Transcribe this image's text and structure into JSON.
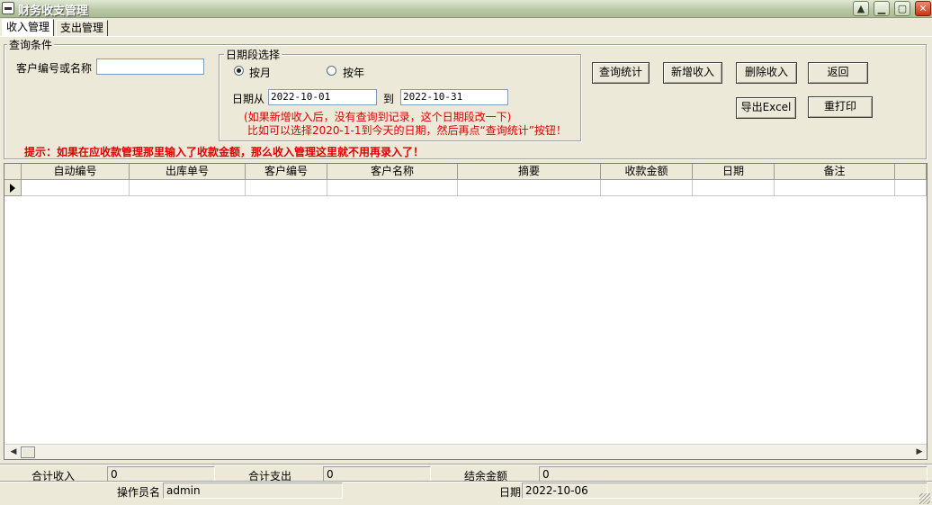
{
  "window": {
    "title": "财务收支管理",
    "controls": [
      "restore-up-icon",
      "minimize-icon",
      "maximize-icon",
      "close-icon"
    ]
  },
  "tabs": [
    {
      "label": "收入管理",
      "active": true
    },
    {
      "label": "支出管理",
      "active": false
    }
  ],
  "query": {
    "group_label": "查询条件",
    "customer_label": "客户编号或名称",
    "customer_value": ""
  },
  "date_range": {
    "group_label": "日期段选择",
    "radio_month": "按月",
    "radio_year": "按年",
    "selected": "按月",
    "from_label": "日期从",
    "from_value": "2022-10-01",
    "to_label": "到",
    "to_value": "2022-10-31",
    "note_line1": "(如果新增收入后，没有查询到记录，这个日期段改一下)",
    "note_line2": "比如可以选择2020-1-1到今天的日期，然后再点“查询统计”按钮！"
  },
  "buttons": {
    "query": "查询统计",
    "add": "新增收入",
    "delete": "删除收入",
    "back": "返回",
    "export": "导出Excel",
    "reprint": "重打印"
  },
  "tip": "提示：如果在应收款管理那里输入了收款金额，那么收入管理这里就不用再录入了！",
  "grid": {
    "columns": [
      "自动编号",
      "出库单号",
      "客户编号",
      "客户名称",
      "摘要",
      "收款金额",
      "日期",
      "备注"
    ],
    "rows": []
  },
  "summary": {
    "income_label": "合计收入",
    "income_value": "0",
    "expense_label": "合计支出",
    "expense_value": "0",
    "balance_label": "结余金额",
    "balance_value": "0",
    "operator_label": "操作员名",
    "operator_value": "admin",
    "date_label": "日期",
    "date_value": "2022-10-06"
  }
}
